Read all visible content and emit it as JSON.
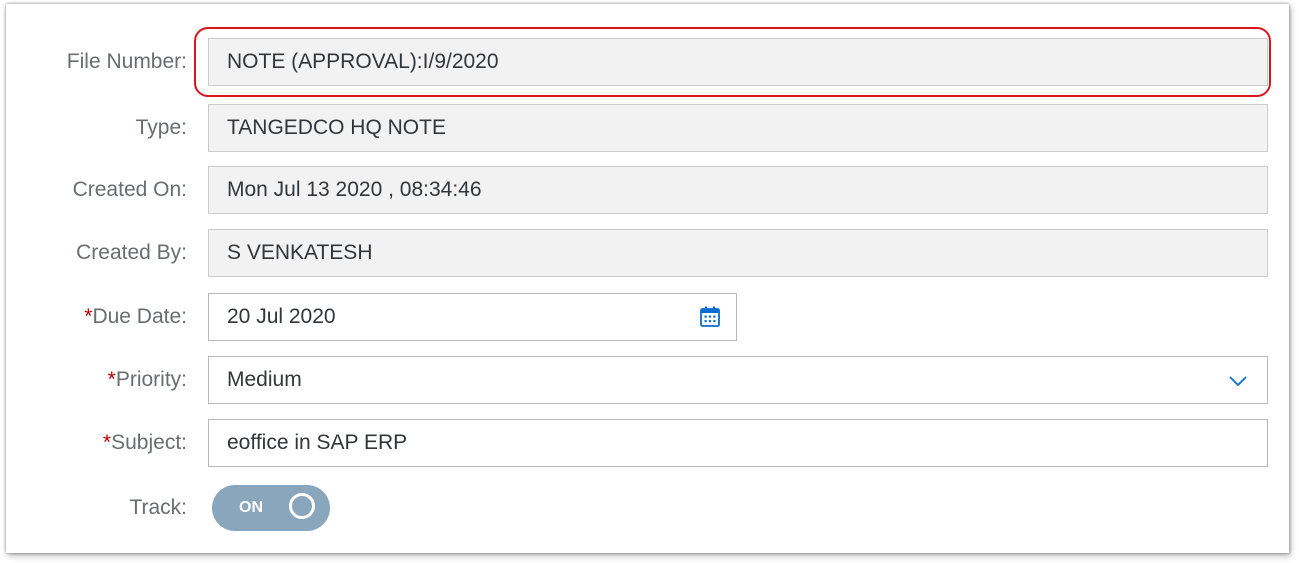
{
  "form": {
    "file_number": {
      "label": "File Number:",
      "value": "NOTE (APPROVAL):I/9/2020"
    },
    "type": {
      "label": "Type:",
      "value": "TANGEDCO HQ NOTE"
    },
    "created_on": {
      "label": "Created On:",
      "value": "Mon Jul 13 2020 , 08:34:46"
    },
    "created_by": {
      "label": "Created By:",
      "value": "S VENKATESH"
    },
    "due_date": {
      "required_mark": "*",
      "label": "Due Date:",
      "value": "20 Jul 2020",
      "icon": "calendar-icon"
    },
    "priority": {
      "required_mark": "*",
      "label": "Priority:",
      "value": "Medium",
      "icon": "chevron-down-icon"
    },
    "subject": {
      "required_mark": "*",
      "label": "Subject:",
      "value": "eoffice in SAP ERP"
    },
    "track": {
      "label": "Track:",
      "toggle_text": "ON",
      "state": true
    }
  },
  "colors": {
    "highlight_border": "#d9161c",
    "required_mark": "#bb0000",
    "toggle_on": "#8aa6bd",
    "icon_blue": "#0a6ed1",
    "readonly_background": "#f2f2f2"
  }
}
